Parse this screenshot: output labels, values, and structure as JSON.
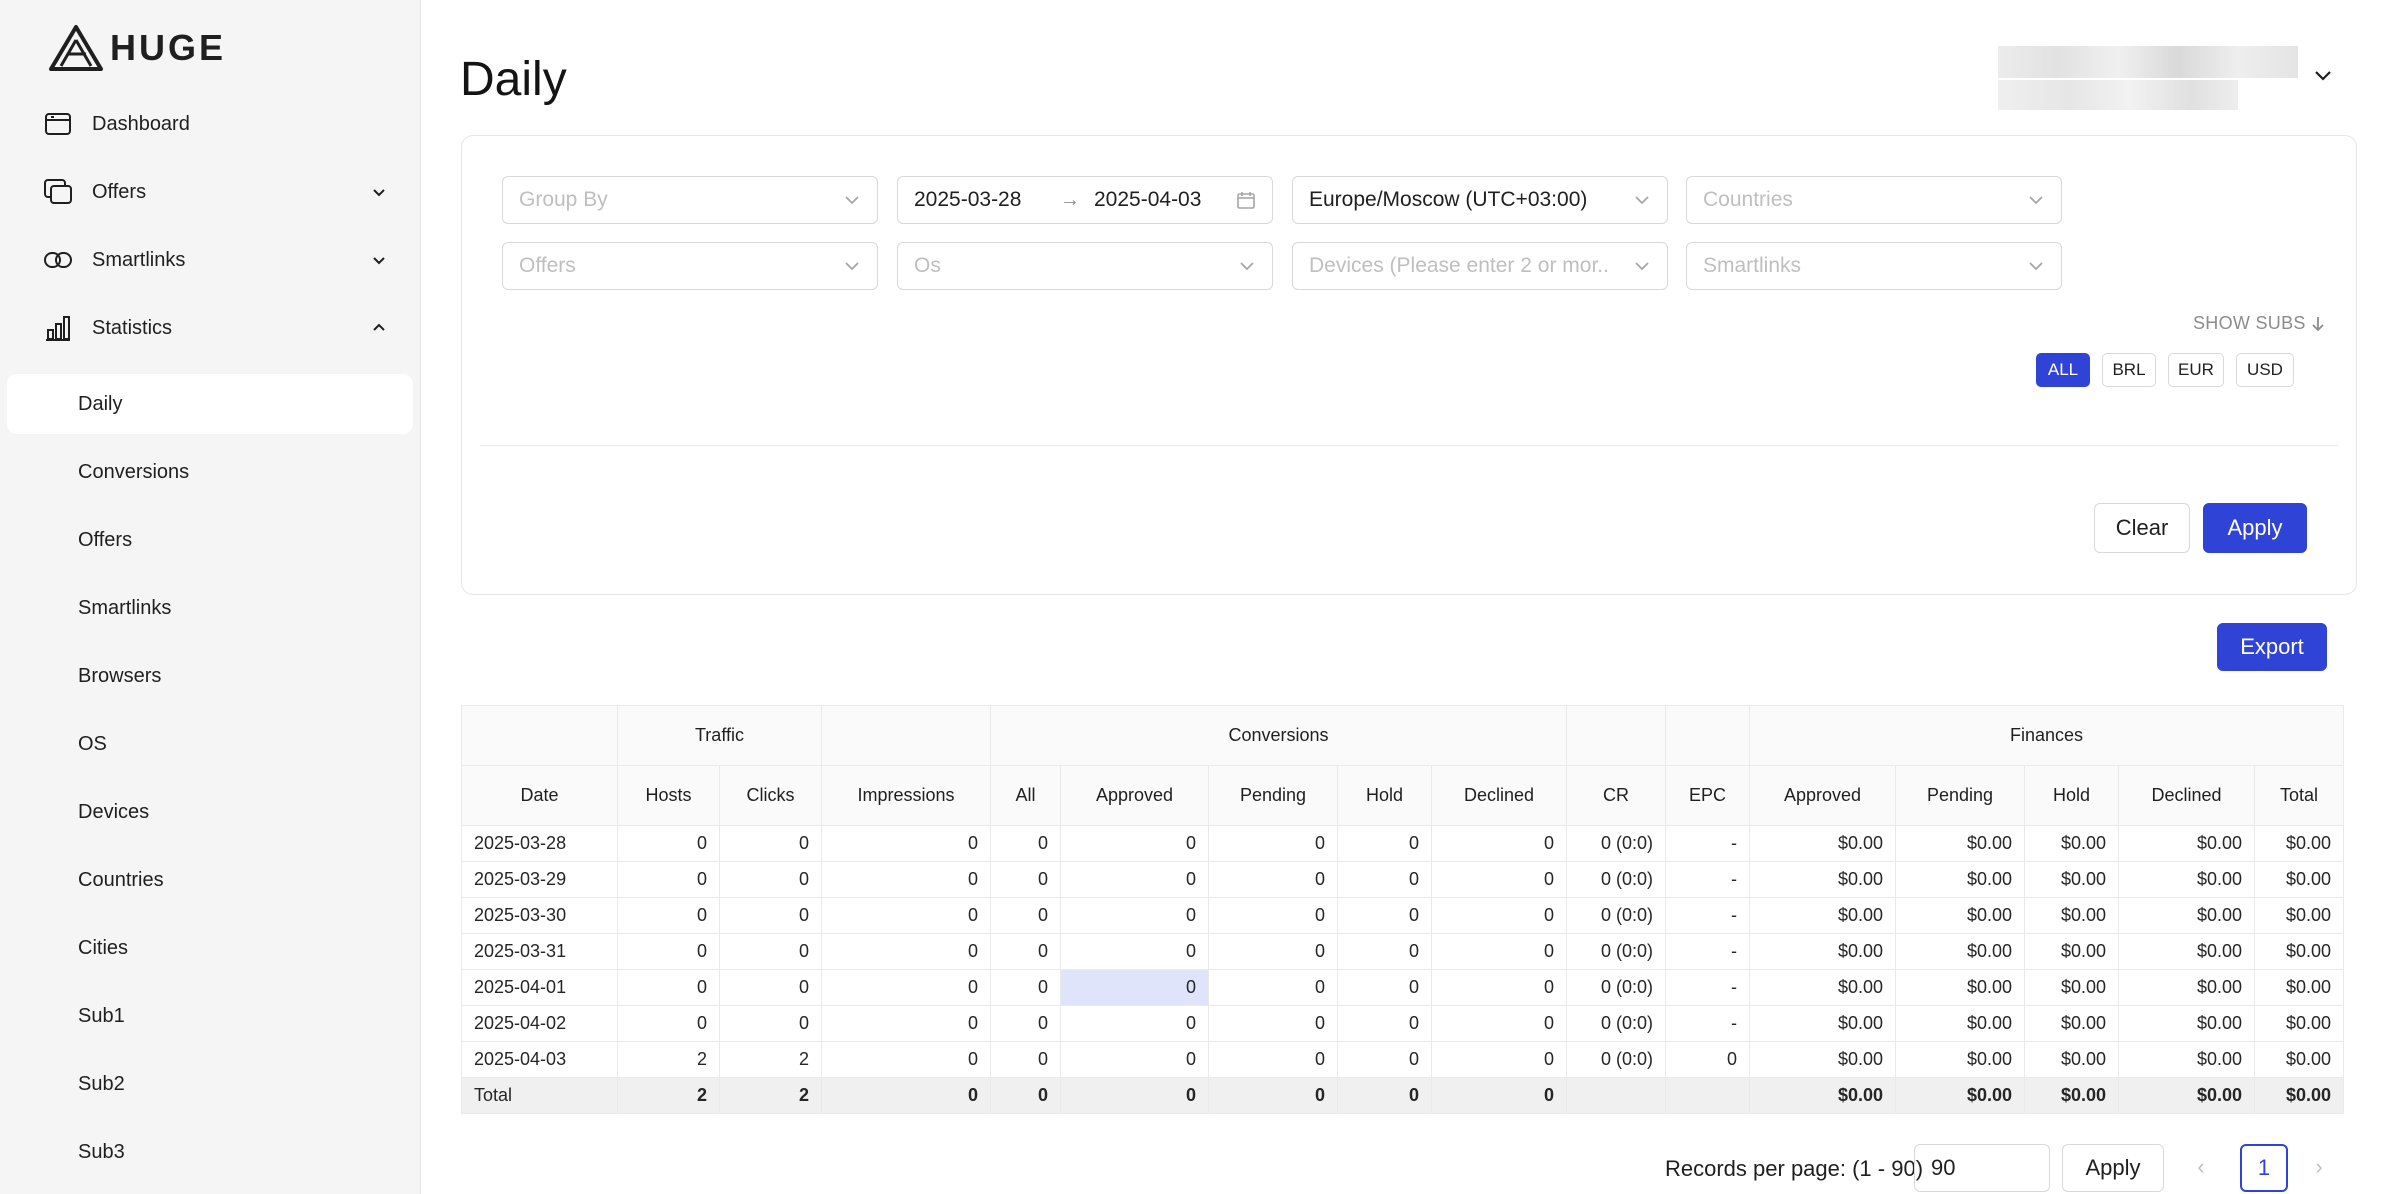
{
  "brand": {
    "logo_text": "HUGE",
    "accent": "#2f44d6"
  },
  "sidebar": {
    "items": [
      {
        "label": "Dashboard",
        "icon": "dashboard-icon"
      },
      {
        "label": "Offers",
        "icon": "offers-icon"
      },
      {
        "label": "Smartlinks",
        "icon": "link-icon"
      },
      {
        "label": "Statistics",
        "icon": "bar-chart-icon"
      }
    ],
    "statistics_sub": [
      "Daily",
      "Conversions",
      "Offers",
      "Smartlinks",
      "Browsers",
      "OS",
      "Devices",
      "Countries",
      "Cities",
      "Sub1",
      "Sub2",
      "Sub3"
    ]
  },
  "page": {
    "title": "Daily"
  },
  "filters": {
    "group_by_placeholder": "Group By",
    "date_from": "2025-03-28",
    "date_arrow": "→",
    "date_to": "2025-04-03",
    "timezone": "Europe/Moscow (UTC+03:00)",
    "countries_placeholder": "Countries",
    "offers_placeholder": "Offers",
    "os_placeholder": "Os",
    "devices_placeholder": "Devices (Please enter 2 or mor...",
    "smartlinks_placeholder": "Smartlinks",
    "show_subs": "SHOW SUBS",
    "currencies": [
      "ALL",
      "BRL",
      "EUR",
      "USD"
    ],
    "active_currency": "ALL",
    "clear_label": "Clear",
    "apply_label": "Apply"
  },
  "export_label": "Export",
  "table": {
    "groups": {
      "traffic": "Traffic",
      "conversions": "Conversions",
      "finances": "Finances"
    },
    "columns": [
      "Date",
      "Hosts",
      "Clicks",
      "Impressions",
      "All",
      "Approved",
      "Pending",
      "Hold",
      "Declined",
      "CR",
      "EPC",
      "Approved",
      "Pending",
      "Hold",
      "Declined",
      "Total"
    ],
    "rows": [
      [
        "2025-03-28",
        "0",
        "0",
        "0",
        "0",
        "0",
        "0",
        "0",
        "0",
        "0 (0:0)",
        "-",
        "$0.00",
        "$0.00",
        "$0.00",
        "$0.00",
        "$0.00"
      ],
      [
        "2025-03-29",
        "0",
        "0",
        "0",
        "0",
        "0",
        "0",
        "0",
        "0",
        "0 (0:0)",
        "-",
        "$0.00",
        "$0.00",
        "$0.00",
        "$0.00",
        "$0.00"
      ],
      [
        "2025-03-30",
        "0",
        "0",
        "0",
        "0",
        "0",
        "0",
        "0",
        "0",
        "0 (0:0)",
        "-",
        "$0.00",
        "$0.00",
        "$0.00",
        "$0.00",
        "$0.00"
      ],
      [
        "2025-03-31",
        "0",
        "0",
        "0",
        "0",
        "0",
        "0",
        "0",
        "0",
        "0 (0:0)",
        "-",
        "$0.00",
        "$0.00",
        "$0.00",
        "$0.00",
        "$0.00"
      ],
      [
        "2025-04-01",
        "0",
        "0",
        "0",
        "0",
        "0",
        "0",
        "0",
        "0",
        "0 (0:0)",
        "-",
        "$0.00",
        "$0.00",
        "$0.00",
        "$0.00",
        "$0.00"
      ],
      [
        "2025-04-02",
        "0",
        "0",
        "0",
        "0",
        "0",
        "0",
        "0",
        "0",
        "0 (0:0)",
        "-",
        "$0.00",
        "$0.00",
        "$0.00",
        "$0.00",
        "$0.00"
      ],
      [
        "2025-04-03",
        "2",
        "2",
        "0",
        "0",
        "0",
        "0",
        "0",
        "0",
        "0 (0:0)",
        "0",
        "$0.00",
        "$0.00",
        "$0.00",
        "$0.00",
        "$0.00"
      ]
    ],
    "total": [
      "Total",
      "2",
      "2",
      "0",
      "0",
      "0",
      "0",
      "0",
      "0",
      "",
      "",
      "$0.00",
      "$0.00",
      "$0.00",
      "$0.00",
      "$0.00"
    ]
  },
  "pagination": {
    "records_label": "Records per page: (1 - 90)",
    "per_page_value": "90",
    "apply_label": "Apply",
    "current_page": "1",
    "prev_icon": "chevron-left-icon",
    "next_icon": "chevron-right-icon"
  }
}
